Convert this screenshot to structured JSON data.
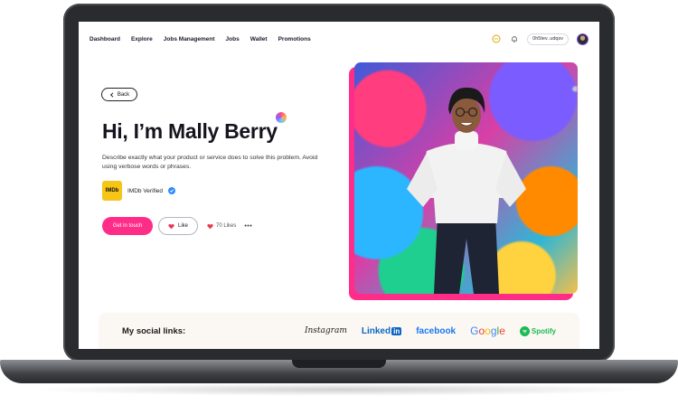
{
  "nav": {
    "links": [
      "Dashboard",
      "Explore",
      "Jobs Management",
      "Jobs",
      "Wallet",
      "Promotions"
    ],
    "wallet_address": "0h5tev..udqsv"
  },
  "profile": {
    "back_label": "Back",
    "title": "Hi, I’m Mally Berry",
    "description": "Describe exactly what your product or service does to solve this problem. Avoid using verbose words or phrases.",
    "imdb_logo_text": "IMDb",
    "imdb_label": "IMDb Verified",
    "contact_label": "Get in touch",
    "like_label": "Like",
    "likes_count": "70 Likes",
    "more_label": "•••"
  },
  "social": {
    "title": "My social links:",
    "logos": {
      "instagram": "Instagram",
      "linkedin_text": "Linked",
      "linkedin_box": "in",
      "facebook": "facebook",
      "google": [
        "G",
        "o",
        "o",
        "g",
        "l",
        "e"
      ],
      "spotify": "Spotify"
    }
  },
  "colors": {
    "accent_pink": "#ff2d87",
    "linkedin_blue": "#0a66c2",
    "facebook_blue": "#1877f2",
    "spotify_green": "#1db954",
    "imdb_yellow": "#f5c518"
  },
  "icons": {
    "chat": "chat-icon",
    "notification": "bell-icon",
    "verified": "verified-check-icon",
    "heart": "heart-icon",
    "back": "chevron-left-icon"
  }
}
